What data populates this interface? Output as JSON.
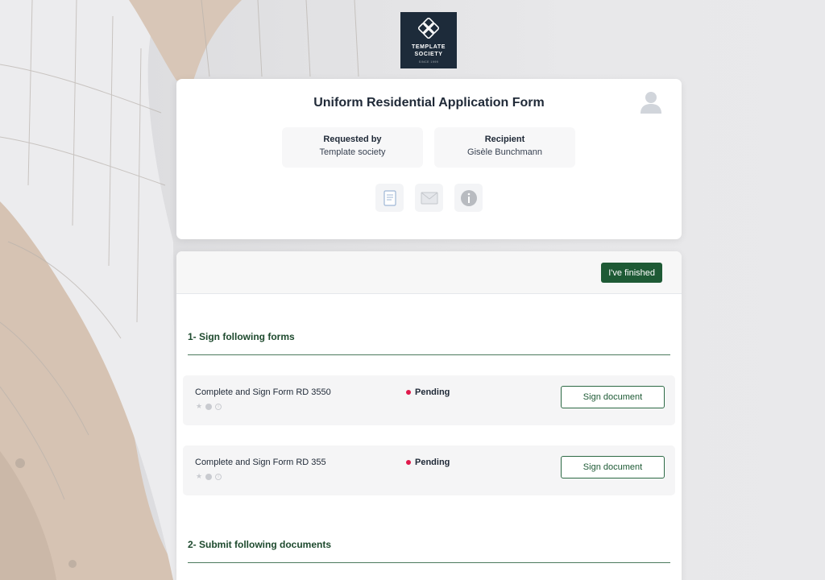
{
  "brand": {
    "logo_name_line1": "TEMPLATE",
    "logo_name_line2": "SOCIETY",
    "logo_since": "SINCE 1999",
    "accent": "#1e5a35",
    "logo_bg": "#1d2b3a"
  },
  "header": {
    "title": "Uniform Residential Application Form",
    "requested_by": {
      "label": "Requested by",
      "value": "Template society"
    },
    "recipient": {
      "label": "Recipient",
      "value": "Gisèle Bunchmann"
    },
    "icons": [
      "document-icon",
      "mail-icon",
      "info-icon"
    ]
  },
  "toolbar": {
    "finished_label": "I've finished"
  },
  "sections": [
    {
      "title": "1- Sign following forms",
      "tasks": [
        {
          "name": "Complete and Sign Form RD 3550",
          "status": "Pending",
          "action": "Sign document"
        },
        {
          "name": "Complete and Sign Form RD 355",
          "status": "Pending",
          "action": "Sign document"
        }
      ]
    },
    {
      "title": "2- Submit following documents"
    }
  ],
  "status_color": "#e0194b"
}
